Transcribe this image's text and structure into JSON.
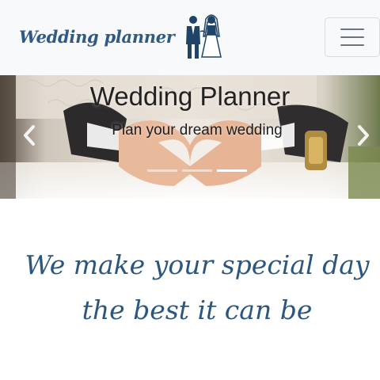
{
  "navbar": {
    "brand_text": "Wedding planner",
    "brand_icon": "bride-groom-icon",
    "toggler_icon": "hamburger-menu-icon"
  },
  "carousel": {
    "title": "Wedding Planner",
    "subtitle": "Plan your dream wedding",
    "prev_icon": "chevron-left-icon",
    "next_icon": "chevron-right-icon",
    "slide_count": 3,
    "active_slide": 3
  },
  "main": {
    "tagline_line1": "We make your special day",
    "tagline_line2": "the best it can be"
  },
  "colors": {
    "brand": "#2f5a84",
    "navbar_bg": "#f8f9fa",
    "tagline": "#2b5680"
  }
}
